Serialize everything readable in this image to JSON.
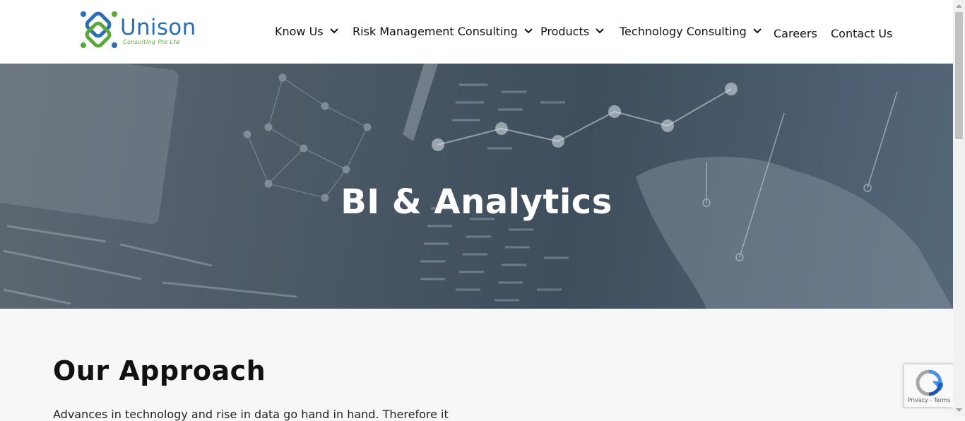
{
  "brand": {
    "name": "Unison",
    "subtitle": "Consulting Pte Ltd",
    "primary_color": "#2a6fb3",
    "secondary_color": "#5aa83a"
  },
  "nav": {
    "items": [
      {
        "label": "Know Us",
        "dropdown": true
      },
      {
        "label": "Risk Management Consulting",
        "dropdown": true
      },
      {
        "label": "Products",
        "dropdown": true
      },
      {
        "label": "Technology Consulting",
        "dropdown": true
      },
      {
        "label": "Careers",
        "dropdown": false
      },
      {
        "label": "Contact Us",
        "dropdown": false
      }
    ]
  },
  "hero": {
    "title": "BI & Analytics"
  },
  "main": {
    "section_title": "Our Approach",
    "intro": "Advances in technology and rise in data go hand in hand. Therefore it"
  },
  "recaptcha": {
    "privacy": "Privacy",
    "separator": " - ",
    "terms": "Terms"
  }
}
